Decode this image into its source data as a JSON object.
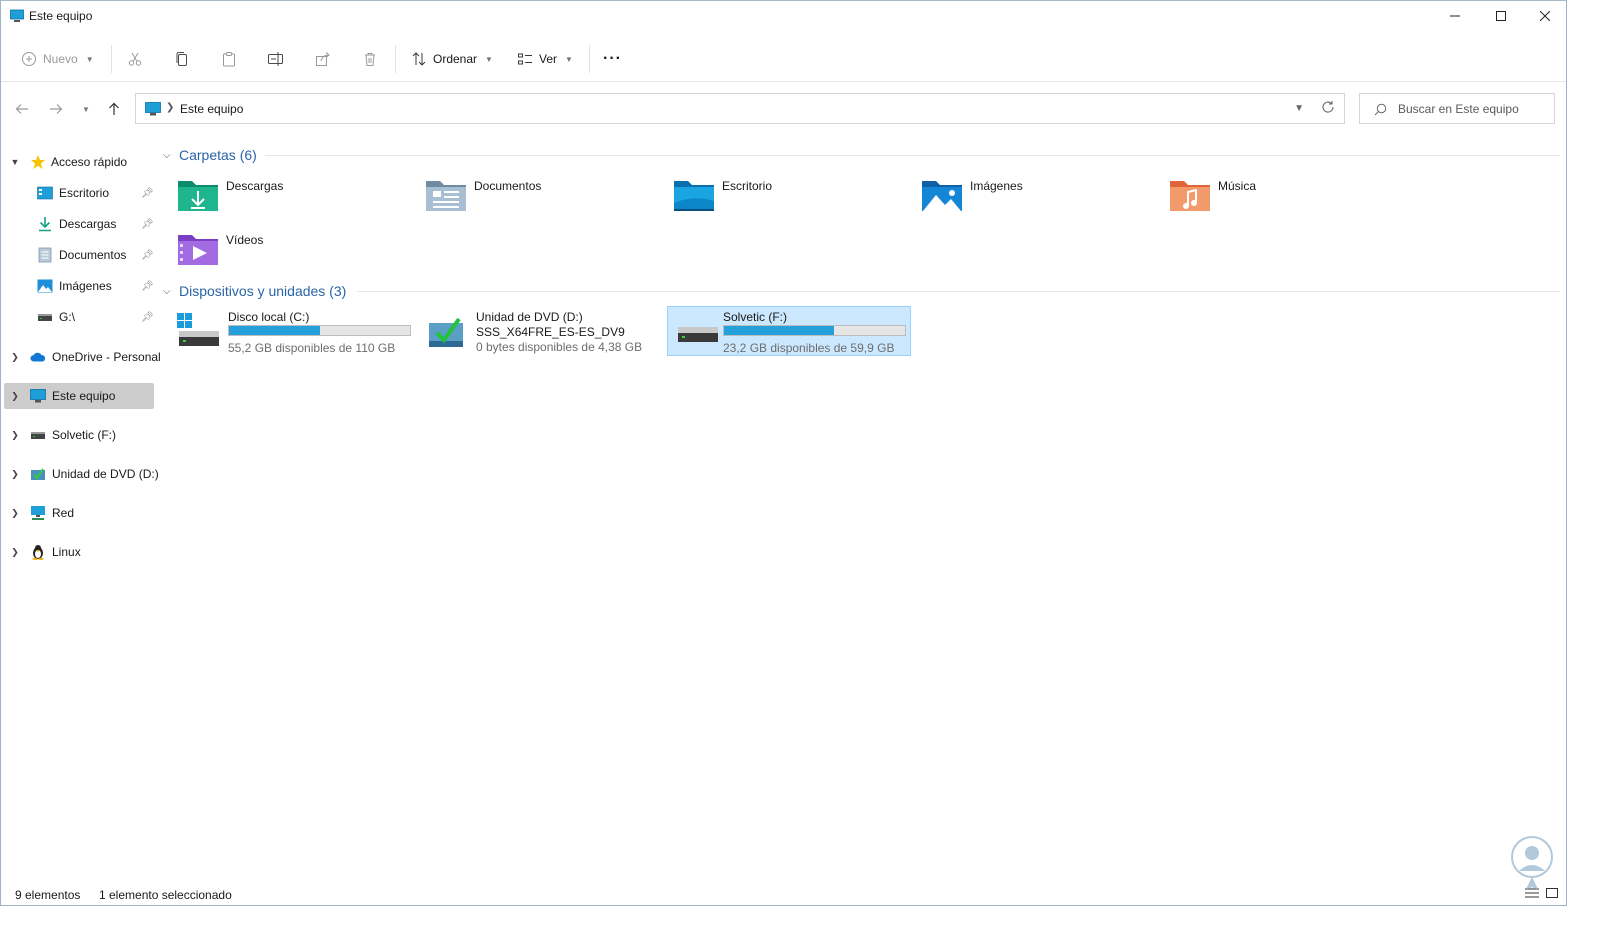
{
  "window": {
    "title": "Este equipo"
  },
  "toolbar": {
    "new_label": "Nuevo",
    "sort_label": "Ordenar",
    "view_label": "Ver",
    "more_label": "···"
  },
  "address": {
    "path": "Este equipo",
    "search_placeholder": "Buscar en Este equipo"
  },
  "sidebar": {
    "items": [
      {
        "label": "Acceso rápido"
      },
      {
        "label": "Escritorio"
      },
      {
        "label": "Descargas"
      },
      {
        "label": "Documentos"
      },
      {
        "label": "Imágenes"
      },
      {
        "label": "G:\\"
      },
      {
        "label": "OneDrive - Personal"
      },
      {
        "label": "Este equipo"
      },
      {
        "label": "Solvetic (F:)"
      },
      {
        "label": "Unidad de DVD (D:)"
      },
      {
        "label": "Red"
      },
      {
        "label": "Linux"
      }
    ]
  },
  "content": {
    "folders_header": "Carpetas (6)",
    "devices_header": "Dispositivos y unidades (3)",
    "folders": [
      {
        "name": "Descargas"
      },
      {
        "name": "Documentos"
      },
      {
        "name": "Escritorio"
      },
      {
        "name": "Imágenes"
      },
      {
        "name": "Música"
      },
      {
        "name": "Vídeos"
      }
    ],
    "drives": [
      {
        "name": "Disco local (C:)",
        "free": "55,2 GB disponibles de 110 GB",
        "used_fraction": 0.5
      },
      {
        "name": "Unidad de DVD (D:)",
        "label": "SSS_X64FRE_ES-ES_DV9",
        "free": "0 bytes disponibles de 4,38 GB"
      },
      {
        "name": "Solvetic (F:)",
        "free": "23,2 GB disponibles de 59,9 GB",
        "used_fraction": 0.61
      }
    ]
  },
  "status": {
    "count": "9 elementos",
    "selected": "1 elemento seleccionado"
  },
  "colors": {
    "accent": "#26a0da",
    "selection": "#cce8ff",
    "header_blue": "#2a64a8"
  }
}
